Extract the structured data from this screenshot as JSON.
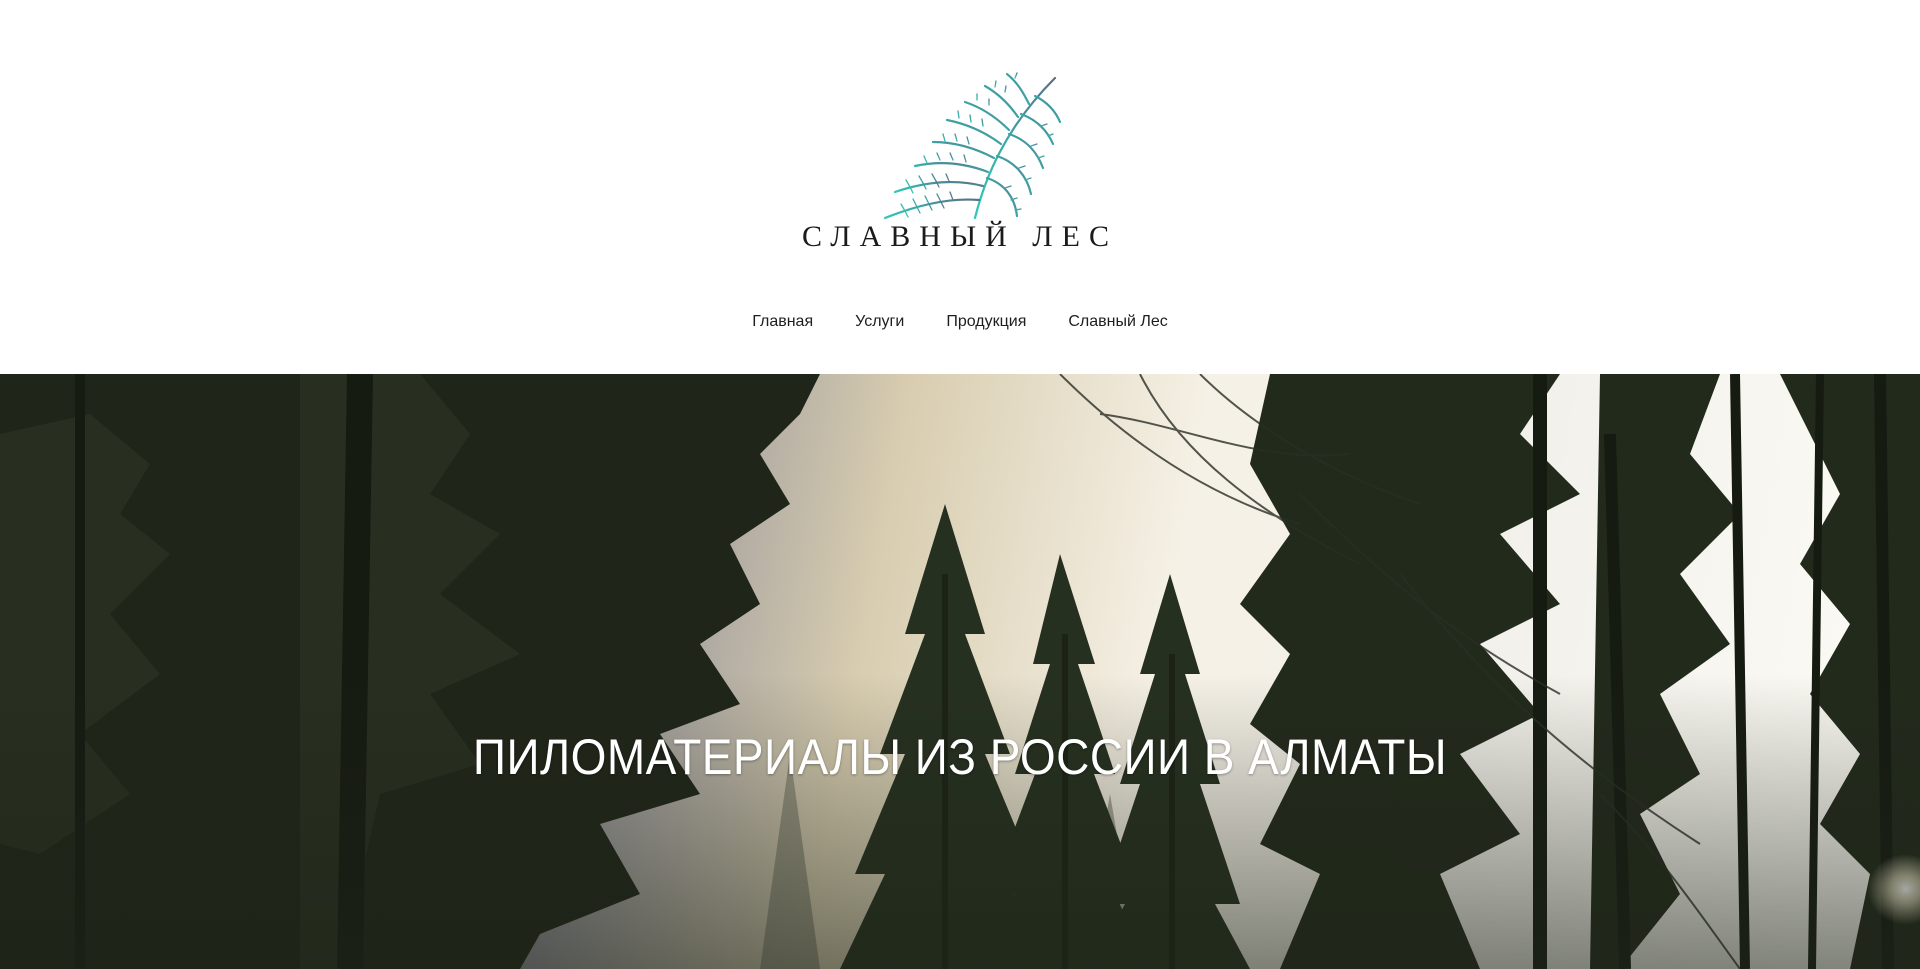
{
  "header": {
    "logo_text": "СЛАВНЫЙ ЛЕС",
    "logo_icon": "fern-branch-icon",
    "colors": {
      "logo_teal": "#2fc7b8",
      "logo_slate": "#5a6e86",
      "text": "#1e1e1e"
    }
  },
  "nav": {
    "items": [
      {
        "label": "Главная"
      },
      {
        "label": "Услуги"
      },
      {
        "label": "Продукция"
      },
      {
        "label": "Славный Лес"
      }
    ]
  },
  "hero": {
    "title": "ПИЛОМАТЕРИАЛЫ ИЗ РОССИИ В АЛМАТЫ",
    "background": "forest-photo"
  }
}
